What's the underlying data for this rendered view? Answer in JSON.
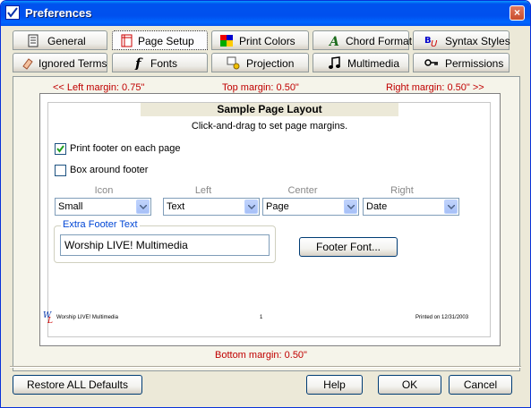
{
  "window": {
    "title": "Preferences",
    "close_glyph": "×"
  },
  "tabs": {
    "general": "General",
    "page_setup": "Page Setup",
    "print_colors": "Print Colors",
    "chord_format": "Chord Format",
    "syntax_styles": "Syntax Styles",
    "ignored_terms": "Ignored Terms",
    "fonts": "Fonts",
    "projection": "Projection",
    "multimedia": "Multimedia",
    "permissions": "Permissions"
  },
  "margins": {
    "left": "<< Left margin: 0.75\"",
    "top": "Top margin: 0.50\"",
    "right": "Right margin: 0.50\" >>",
    "bottom": "Bottom margin: 0.50\""
  },
  "sample": {
    "title": "Sample Page Layout",
    "subtitle": "Click-and-drag to set page margins."
  },
  "options": {
    "print_footer": {
      "label": "Print footer on each page",
      "checked": true
    },
    "box_footer": {
      "label": "Box around footer",
      "checked": false
    }
  },
  "columns": {
    "icon": {
      "header": "Icon",
      "value": "Small"
    },
    "left": {
      "header": "Left",
      "value": "Text"
    },
    "center": {
      "header": "Center",
      "value": "Page"
    },
    "right": {
      "header": "Right",
      "value": "Date"
    }
  },
  "extra_footer": {
    "label": "Extra Footer Text",
    "value": "Worship LIVE! Multimedia"
  },
  "footer_font_button": "Footer Font...",
  "preview_footer": {
    "left": "Worship LIVE! Multimedia",
    "center": "1",
    "right": "Printed on 12/31/2003"
  },
  "buttons": {
    "restore": "Restore ALL Defaults",
    "help": "Help",
    "ok": "OK",
    "cancel": "Cancel"
  },
  "colors": {
    "title_bar": "#0053ee",
    "margin_label": "#c00000",
    "group_label": "#0046d5"
  }
}
